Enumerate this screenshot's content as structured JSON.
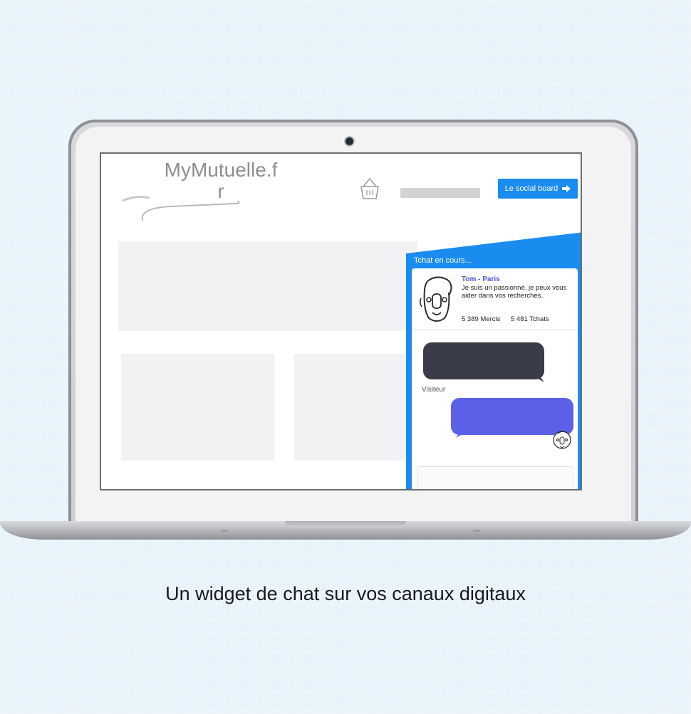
{
  "screen": {
    "brand_text": "MyMutuelle.f\nr",
    "cta_button_label": "Le social board",
    "chat": {
      "header": "Tchat en cours...",
      "agent_name": "Tom - Paris",
      "agent_bio": "Je suis un passionné, je peux vous aider dans vos recherches..",
      "stats": [
        "5 389 Mercis",
        "5 481 Tchats"
      ],
      "visitor_label": "Visiteur"
    }
  },
  "caption": "Un widget de chat sur vos canaux digitaux",
  "colors": {
    "background": "#e3f1fb",
    "accent_blue": "#1a8cf0",
    "agent_bubble": "#5b60e6",
    "visitor_bubble": "#3a3d47"
  },
  "icons": [
    "camera-icon",
    "basket-icon",
    "arrow-right-icon",
    "agent-avatar-icon"
  ]
}
